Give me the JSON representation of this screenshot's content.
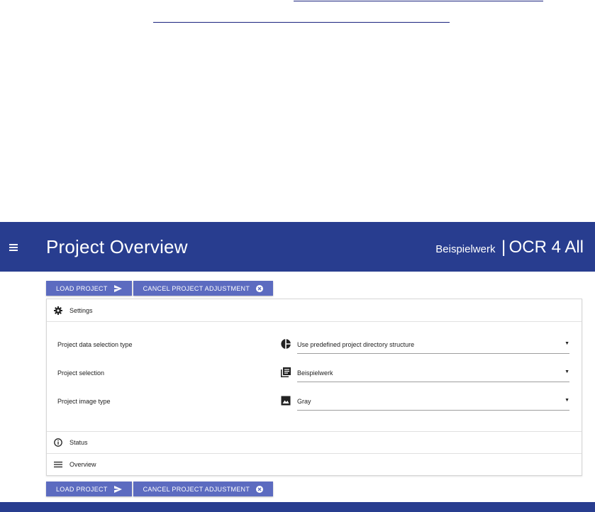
{
  "header": {
    "title": "Project Overview",
    "project_name": "Beispielwerk",
    "separator": "|",
    "app_name": "OCR 4 All"
  },
  "buttons": {
    "load_project": "LOAD PROJECT",
    "cancel_adjustment": "CANCEL PROJECT ADJUSTMENT"
  },
  "settings": {
    "title": "Settings",
    "rows": [
      {
        "label": "Project data selection type",
        "value": "Use predefined project directory structure",
        "icon": "pie-chart-icon"
      },
      {
        "label": "Project selection",
        "value": "Beispielwerk",
        "icon": "library-books-icon"
      },
      {
        "label": "Project image type",
        "value": "Gray",
        "icon": "image-icon"
      }
    ]
  },
  "status": {
    "title": "Status"
  },
  "overview": {
    "title": "Overview"
  },
  "colors": {
    "header_bg": "#283d8f",
    "button_bg": "#5c6bc0",
    "link_line": "#1a237e"
  }
}
